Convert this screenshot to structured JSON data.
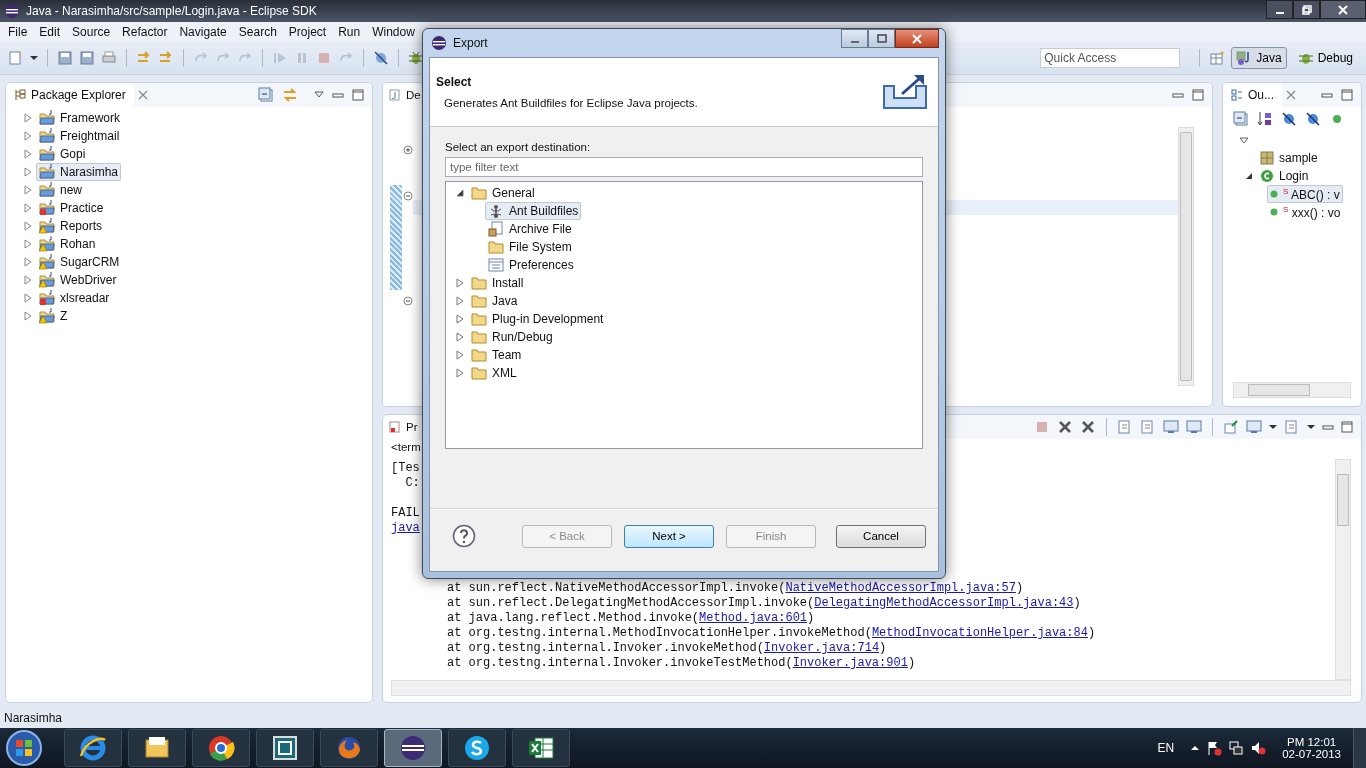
{
  "window": {
    "title": "Java - Narasimha/src/sample/Login.java - Eclipse SDK"
  },
  "menu": [
    "File",
    "Edit",
    "Source",
    "Refactor",
    "Navigate",
    "Search",
    "Project",
    "Run",
    "Window"
  ],
  "quick_access": {
    "placeholder": "Quick Access"
  },
  "perspectives": [
    {
      "label": "Java",
      "kind": "java",
      "selected": true
    },
    {
      "label": "Debug",
      "kind": "debug",
      "selected": false
    }
  ],
  "package_explorer": {
    "title": "Package Explorer",
    "projects": [
      {
        "name": "Framework",
        "kind": "ok",
        "selected": false
      },
      {
        "name": "Freightmail",
        "kind": "ok",
        "selected": false
      },
      {
        "name": "Gopi",
        "kind": "ok",
        "selected": false
      },
      {
        "name": "Narasimha",
        "kind": "ok",
        "selected": true
      },
      {
        "name": "new",
        "kind": "ok",
        "selected": false
      },
      {
        "name": "Practice",
        "kind": "error",
        "selected": false
      },
      {
        "name": "Reports",
        "kind": "warning",
        "selected": false
      },
      {
        "name": "Rohan",
        "kind": "warning",
        "selected": false
      },
      {
        "name": "SugarCRM",
        "kind": "warning",
        "selected": false
      },
      {
        "name": "WebDriver",
        "kind": "warning",
        "selected": false
      },
      {
        "name": "xlsreadar",
        "kind": "error",
        "selected": false
      },
      {
        "name": "Z",
        "kind": "warning",
        "selected": false
      }
    ]
  },
  "editor": {
    "tab": "De"
  },
  "outline": {
    "title": "Ou...",
    "items": [
      {
        "label": "sample",
        "kind": "package",
        "selected": false
      },
      {
        "label": "Login",
        "kind": "class",
        "selected": false,
        "expanded": true,
        "children": [
          {
            "label": "$^{S}$ ABC() : v",
            "kind": "method",
            "selected": true
          },
          {
            "label": "$^{S}$ xxx() : vo",
            "kind": "method",
            "selected": false
          }
        ]
      }
    ]
  },
  "console": {
    "tab": "Pr",
    "header": "<term",
    "lines": [
      "[Tes",
      "  C:"
    ],
    "fail": "FAIL",
    "fail_link": "java",
    "trace": [
      {
        "text": "at sun.reflect.NativeMethodAccessorImpl.invoke(",
        "link": "NativeMethodAccessorImpl.java:57",
        "end": ")"
      },
      {
        "text": "at sun.reflect.DelegatingMethodAccessorImpl.invoke(",
        "link": "DelegatingMethodAccessorImpl.java:43",
        "end": ")"
      },
      {
        "text": "at java.lang.reflect.Method.invoke(",
        "link": "Method.java:601",
        "end": ")"
      },
      {
        "text": "at org.testng.internal.MethodInvocationHelper.invokeMethod(",
        "link": "MethodInvocationHelper.java:84",
        "end": ")"
      },
      {
        "text": "at org.testng.internal.Invoker.invokeMethod(",
        "link": "Invoker.java:714",
        "end": ")"
      },
      {
        "text": "at org.testng.internal.Invoker.invokeTestMethod(",
        "link": "Invoker.java:901",
        "end": ")"
      }
    ]
  },
  "status_bar": {
    "text": "Narasimha"
  },
  "dialog": {
    "title": "Export",
    "heading": "Select",
    "description": "Generates Ant Buildfiles for Eclipse Java projects.",
    "prompt": "Select an export destination:",
    "filter": {
      "placeholder": "type filter text"
    },
    "tree": [
      {
        "label": "General",
        "kind": "folder",
        "expanded": true,
        "selected": false,
        "children": [
          {
            "label": "Ant Buildfiles",
            "kind": "ant",
            "selected": true
          },
          {
            "label": "Archive File",
            "kind": "archive",
            "selected": false
          },
          {
            "label": "File System",
            "kind": "folder",
            "selected": false
          },
          {
            "label": "Preferences",
            "kind": "prefs",
            "selected": false
          }
        ]
      },
      {
        "label": "Install",
        "kind": "folder",
        "expanded": false,
        "selected": false
      },
      {
        "label": "Java",
        "kind": "folder",
        "expanded": false,
        "selected": false
      },
      {
        "label": "Plug-in Development",
        "kind": "folder",
        "expanded": false,
        "selected": false
      },
      {
        "label": "Run/Debug",
        "kind": "folder",
        "expanded": false,
        "selected": false
      },
      {
        "label": "Team",
        "kind": "folder",
        "expanded": false,
        "selected": false
      },
      {
        "label": "XML",
        "kind": "folder",
        "expanded": false,
        "selected": false
      }
    ],
    "buttons": [
      {
        "label": "< Back",
        "disabled": true,
        "default": false
      },
      {
        "label": "Next >",
        "disabled": false,
        "default": true
      },
      {
        "label": "Finish",
        "disabled": true,
        "default": false
      },
      {
        "label": "Cancel",
        "disabled": false,
        "default": false
      }
    ]
  },
  "taskbar": {
    "apps": [
      {
        "kind": "ie",
        "active": false
      },
      {
        "kind": "explorer",
        "active": false
      },
      {
        "kind": "chrome",
        "active": false
      },
      {
        "kind": "vm",
        "active": false
      },
      {
        "kind": "firefox",
        "active": false
      },
      {
        "kind": "eclipse",
        "active": true
      },
      {
        "kind": "skype",
        "active": false
      },
      {
        "kind": "excel",
        "active": false
      }
    ],
    "language": "EN",
    "time": "PM 12:01",
    "date": "02-07-2013"
  }
}
